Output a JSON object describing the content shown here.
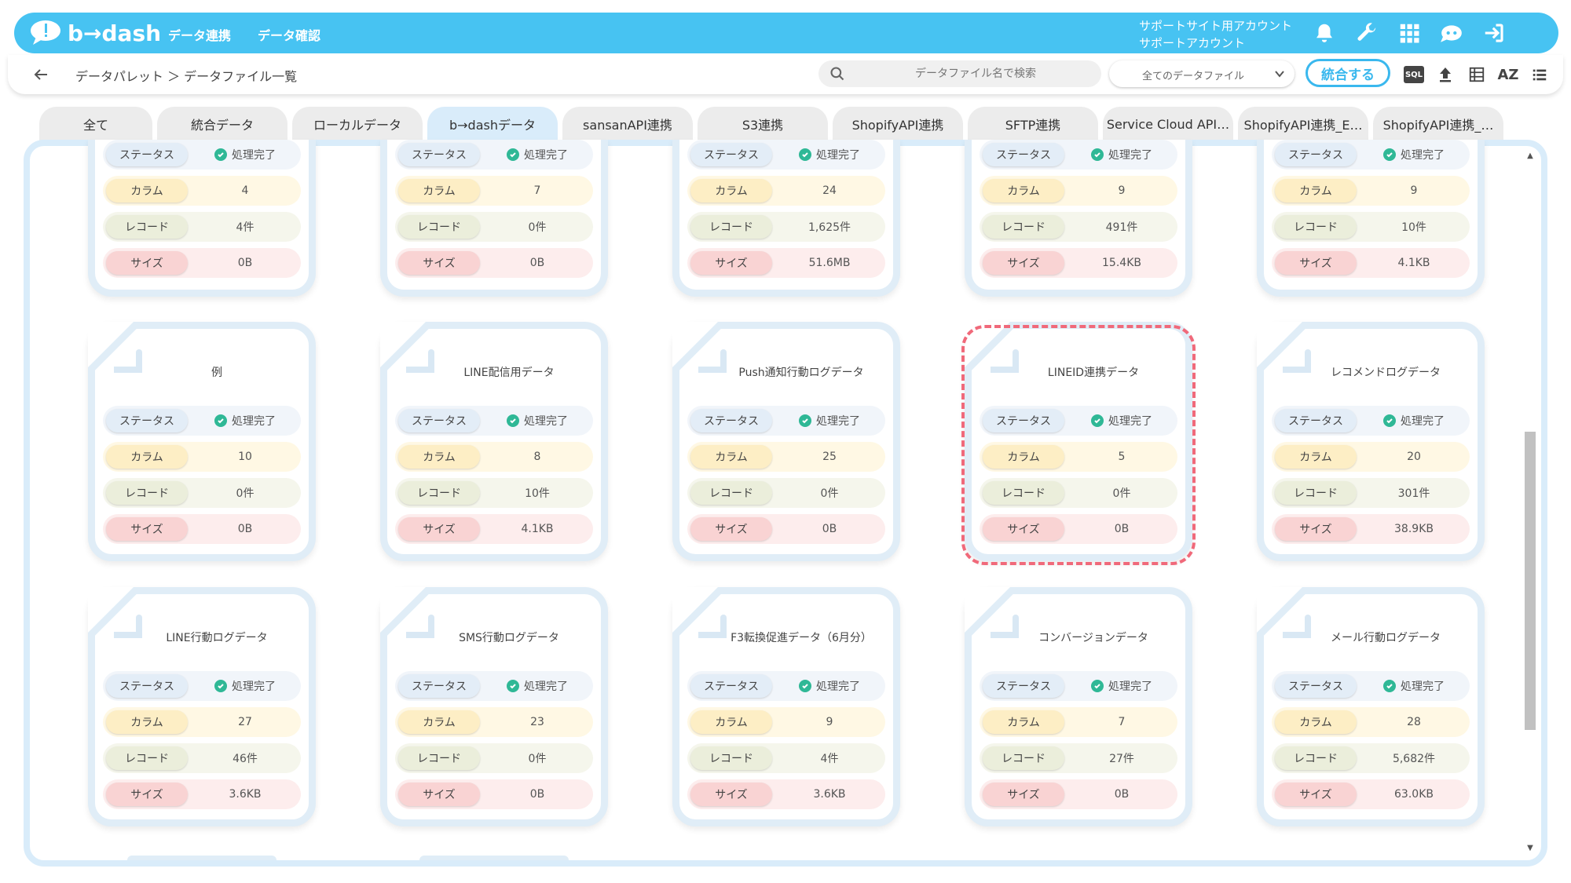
{
  "header": {
    "logo_text": "b→dash",
    "nav": [
      "データ連携",
      "データ確認"
    ],
    "account_line1": "サポートサイト用アカウント",
    "account_line2": "サポートアカウント",
    "icons": [
      "bell-icon",
      "wrench-icon",
      "apps-grid-icon",
      "chat-bot-icon",
      "logout-icon"
    ]
  },
  "subbar": {
    "breadcrumb": "データパレット ＞ データファイル一覧",
    "search_placeholder": "データファイル名で検索",
    "filter_selected": "全てのデータファイル",
    "merge_label": "統合する",
    "sql_label": "SQL",
    "az_label": "AZ"
  },
  "tabs": [
    {
      "label": "全て",
      "active": false
    },
    {
      "label": "統合データ",
      "active": false
    },
    {
      "label": "ローカルデータ",
      "active": false
    },
    {
      "label": "b→dashデータ",
      "active": true
    },
    {
      "label": "sansanAPI連携",
      "active": false
    },
    {
      "label": "S3連携",
      "active": false
    },
    {
      "label": "ShopifyAPI連携",
      "active": false
    },
    {
      "label": "SFTP連携",
      "active": false
    },
    {
      "label": "Service Cloud API…",
      "active": false
    },
    {
      "label": "ShopifyAPI連携_E…",
      "active": false
    },
    {
      "label": "ShopifyAPI連携_…",
      "active": false
    }
  ],
  "row_labels": {
    "status": "ステータス",
    "column": "カラム",
    "record": "レコード",
    "size": "サイズ"
  },
  "cards_top_partial": [
    {
      "status": "処理完了",
      "column": "4",
      "record": "4件",
      "size": "0B"
    },
    {
      "status": "処理完了",
      "column": "7",
      "record": "0件",
      "size": "0B"
    },
    {
      "status": "処理完了",
      "column": "24",
      "record": "1,625件",
      "size": "51.6MB"
    },
    {
      "status": "処理完了",
      "column": "9",
      "record": "491件",
      "size": "15.4KB"
    },
    {
      "status": "処理完了",
      "column": "9",
      "record": "10件",
      "size": "4.1KB"
    }
  ],
  "cards_row2": [
    {
      "title": "例",
      "status": "処理完了",
      "column": "10",
      "record": "0件",
      "size": "0B"
    },
    {
      "title": "LINE配信用データ",
      "status": "処理完了",
      "column": "8",
      "record": "10件",
      "size": "4.1KB"
    },
    {
      "title": "Push通知行動ログデータ",
      "status": "処理完了",
      "column": "25",
      "record": "0件",
      "size": "0B"
    },
    {
      "title": "LINEID連携データ",
      "status": "処理完了",
      "column": "5",
      "record": "0件",
      "size": "0B"
    },
    {
      "title": "レコメンドログデータ",
      "status": "処理完了",
      "column": "20",
      "record": "301件",
      "size": "38.9KB"
    }
  ],
  "cards_row3": [
    {
      "title": "LINE行動ログデータ",
      "status": "処理完了",
      "column": "27",
      "record": "46件",
      "size": "3.6KB"
    },
    {
      "title": "SMS行動ログデータ",
      "status": "処理完了",
      "column": "23",
      "record": "0件",
      "size": "0B"
    },
    {
      "title": "F3転換促進データ（6月分）",
      "status": "処理完了",
      "column": "9",
      "record": "4件",
      "size": "3.6KB"
    },
    {
      "title": "コンバージョンデータ",
      "status": "処理完了",
      "column": "7",
      "record": "27件",
      "size": "0B"
    },
    {
      "title": "メール行動ログデータ",
      "status": "処理完了",
      "column": "28",
      "record": "5,682件",
      "size": "63.0KB"
    }
  ],
  "colors": {
    "brand": "#47c3f2",
    "status_ok": "#2fb896",
    "highlight": "#f0697a"
  }
}
